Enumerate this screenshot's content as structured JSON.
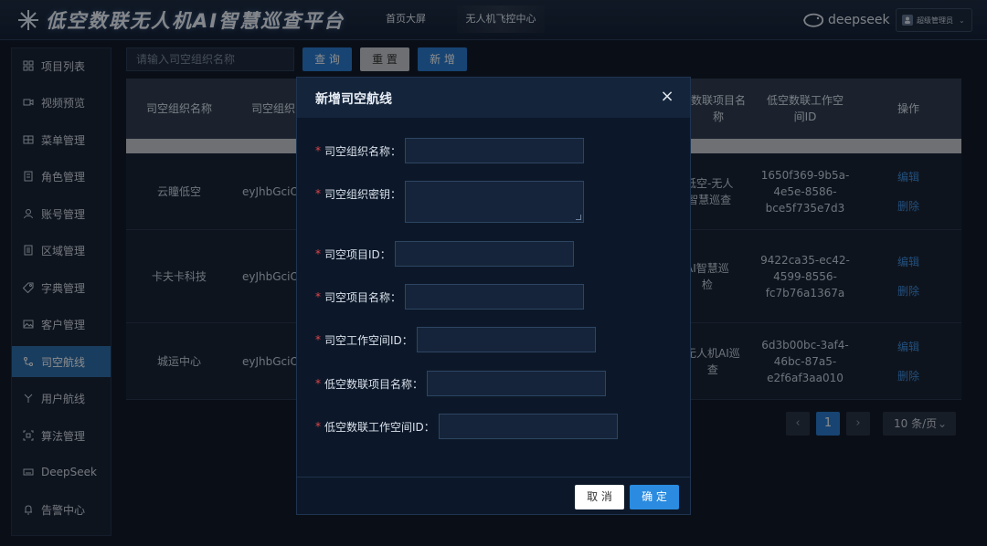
{
  "header": {
    "title": "低空数联无人机AI智慧巡查平台",
    "nav": [
      "首页大屏",
      "无人机飞控中心"
    ],
    "brand": "deepseek",
    "user": "超级管理员"
  },
  "sidebar": {
    "items": [
      {
        "label": "项目列表",
        "icon": "grid-icon"
      },
      {
        "label": "视频预览",
        "icon": "video-icon"
      },
      {
        "label": "菜单管理",
        "icon": "table-icon"
      },
      {
        "label": "角色管理",
        "icon": "document-icon"
      },
      {
        "label": "账号管理",
        "icon": "user-icon"
      },
      {
        "label": "区域管理",
        "icon": "list-icon"
      },
      {
        "label": "字典管理",
        "icon": "tag-icon"
      },
      {
        "label": "客户管理",
        "icon": "image-icon"
      },
      {
        "label": "司空航线",
        "icon": "route-icon"
      },
      {
        "label": "用户航线",
        "icon": "branch-icon"
      },
      {
        "label": "算法管理",
        "icon": "scan-icon"
      },
      {
        "label": "DeepSeek",
        "icon": "keyboard-icon"
      },
      {
        "label": "告警中心",
        "icon": "bell-icon"
      }
    ],
    "active_index": 8
  },
  "toolbar": {
    "search_placeholder": "请输入司空组织名称",
    "query_label": "查 询",
    "reset_label": "重 置",
    "add_label": "新 增"
  },
  "table": {
    "headers": [
      "司空组织名称",
      "司空组织",
      "数联项目名\n称",
      "低空数联工作空\n间ID",
      "操作"
    ],
    "rows": [
      {
        "name": "云瞳低空",
        "key": "eyJhbGciO",
        "project": "低空-无人\n智慧巡查",
        "workspace": "1650f369-9b5a-\n4e5e-8586-\nbce5f735e7d3"
      },
      {
        "name": "卡夫卡科技",
        "key": "eyJhbGciO",
        "project": "AI智慧巡\n检",
        "workspace": "9422ca35-ec42-\n4599-8556-\nfc7b76a1367a"
      },
      {
        "name": "城运中心",
        "key": "eyJhbGciO",
        "project": "无人机AI巡\n查",
        "workspace": "6d3b00bc-3af4-\n46bc-87a5-\ne2f6af3aa010"
      }
    ],
    "edit_label": "编辑",
    "delete_label": "删除"
  },
  "pagination": {
    "prev": "‹",
    "current": "1",
    "next": "›",
    "page_size": "10 条/页"
  },
  "modal": {
    "title": "新增司空航线",
    "close": "×",
    "fields": [
      "司空组织名称：",
      "司空组织密钥：",
      "司空项目ID：",
      "司空项目名称：",
      "司空工作空间ID：",
      "低空数联项目名称：",
      "低空数联工作空间ID："
    ],
    "cancel_label": "取 消",
    "ok_label": "确 定"
  }
}
